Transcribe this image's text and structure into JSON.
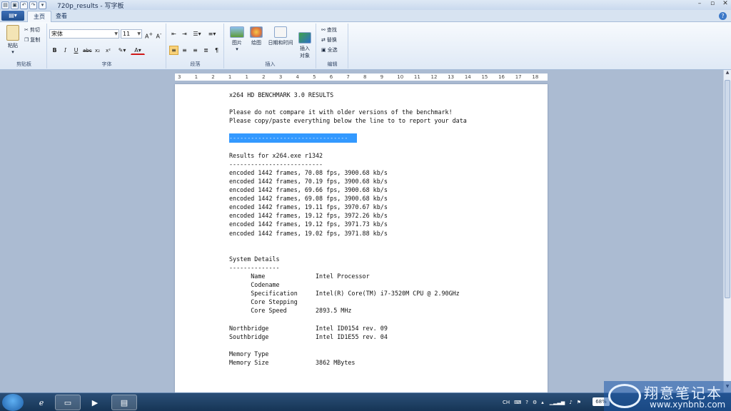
{
  "window": {
    "title": "720p_results - 写字板",
    "controls": [
      "–",
      "▫",
      "✕"
    ]
  },
  "ribbon": {
    "file_menu_label": "",
    "tabs": [
      {
        "label": "主页",
        "active": true
      },
      {
        "label": "查看",
        "active": false
      }
    ],
    "clipboard": {
      "label": "剪贴板",
      "paste": "粘贴",
      "cut": "剪切",
      "copy": "复制"
    },
    "font": {
      "label": "字体",
      "family": "宋体",
      "size": "11"
    },
    "paragraph": {
      "label": "段落"
    },
    "insert": {
      "label": "插入",
      "picture": "图片",
      "paint": "绘图",
      "datetime": "日期和时间",
      "object": "插入\n对象"
    },
    "editing": {
      "label": "编辑",
      "find": "查找",
      "replace": "替换",
      "select_all": "全选"
    }
  },
  "ruler": {
    "ticks": [
      "3",
      "1",
      "2",
      "1",
      "1",
      "2",
      "3",
      "4",
      "5",
      "6",
      "7",
      "8",
      "9",
      "10",
      "11",
      "12",
      "13",
      "14",
      "15",
      "16",
      "17",
      "18"
    ]
  },
  "document": {
    "lines": [
      "x264 HD BENCHMARK 3.0 RESULTS",
      "",
      "Please do not compare it with older versions of the benchmark!",
      "Please copy/paste everything below the line to to report your data",
      "",
      "",
      "",
      "Results for x264.exe r1342",
      "--------------------------",
      "encoded 1442 frames, 70.08 fps, 3900.68 kb/s",
      "encoded 1442 frames, 70.19 fps, 3900.68 kb/s",
      "encoded 1442 frames, 69.66 fps, 3900.68 kb/s",
      "encoded 1442 frames, 69.08 fps, 3900.68 kb/s",
      "encoded 1442 frames, 19.11 fps, 3970.67 kb/s",
      "encoded 1442 frames, 19.12 fps, 3972.26 kb/s",
      "encoded 1442 frames, 19.12 fps, 3971.73 kb/s",
      "encoded 1442 frames, 19.02 fps, 3971.88 kb/s",
      "",
      "",
      "System Details",
      "--------------",
      "      Name              Intel Processor",
      "      Codename",
      "      Specification     Intel(R) Core(TM) i7-3520M CPU @ 2.90GHz",
      "      Core Stepping",
      "      Core Speed        2893.5 MHz",
      "",
      "Northbridge             Intel ID0154 rev. 09",
      "Southbridge             Intel ID1E55 rev. 04",
      "",
      "Memory Type",
      "Memory Size             3862 MBytes",
      ""
    ],
    "selected_line": "---------------------------------"
  },
  "taskbar": {
    "tray_lang": "CH",
    "battery": "68%"
  },
  "watermark": {
    "brand": "翔意笔记本",
    "url": "www.xynbnb.com"
  }
}
